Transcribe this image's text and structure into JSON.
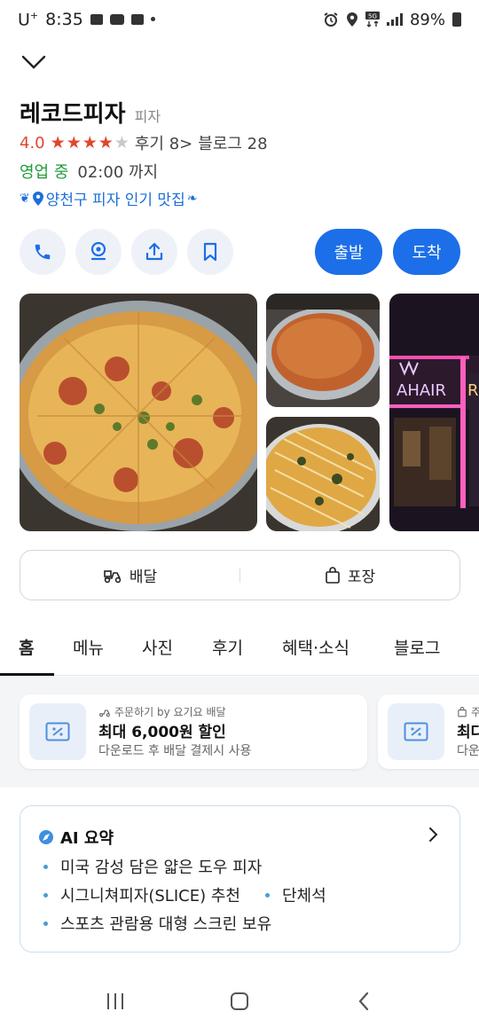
{
  "status_bar": {
    "carrier": "U",
    "carrier_sup": "+",
    "time": "8:35",
    "battery": "89%"
  },
  "place": {
    "name": "레코드피자",
    "category": "피자",
    "rating": "4.0",
    "rating_value": 4.0,
    "rating_max": 5,
    "review_link": "후기 8>",
    "blog_link": "블로그 28",
    "open_status": "영업 중",
    "close_time": "02:00 까지",
    "tag": "양천구 피자 인기 맛집"
  },
  "actions": {
    "call_icon": "phone-icon",
    "map_icon": "map-pin-icon",
    "share_icon": "share-icon",
    "save_icon": "bookmark-icon",
    "depart_label": "출발",
    "arrive_label": "도착"
  },
  "service": {
    "delivery_label": "배달",
    "takeout_label": "포장"
  },
  "tabs": [
    {
      "label": "홈",
      "active": true
    },
    {
      "label": "메뉴"
    },
    {
      "label": "사진"
    },
    {
      "label": "후기"
    },
    {
      "label": "혜택·소식"
    },
    {
      "label": "블로그"
    }
  ],
  "coupons": [
    {
      "source": "주문하기 by 요기요 배달",
      "title": "최대 6,000원 할인",
      "desc": "다운로드 후 배달 결제시 사용"
    },
    {
      "source": "주",
      "title": "최다",
      "desc": "다운"
    }
  ],
  "ai_summary": {
    "title": "AI 요약",
    "items": [
      "미국 감성 담은 얇은 도우 피자",
      "시그니쳐피자(SLICE) 추천",
      "단체석",
      "스포츠 관람용 대형 스크린 보유"
    ]
  },
  "photo_text": {
    "neon_sign": "AHAIR",
    "neon_r": "R"
  },
  "colors": {
    "accent_blue": "#1c6fe8",
    "rating_red": "#e2452f",
    "open_green": "#1e9b3a",
    "tag_blue": "#1c6fd9"
  }
}
